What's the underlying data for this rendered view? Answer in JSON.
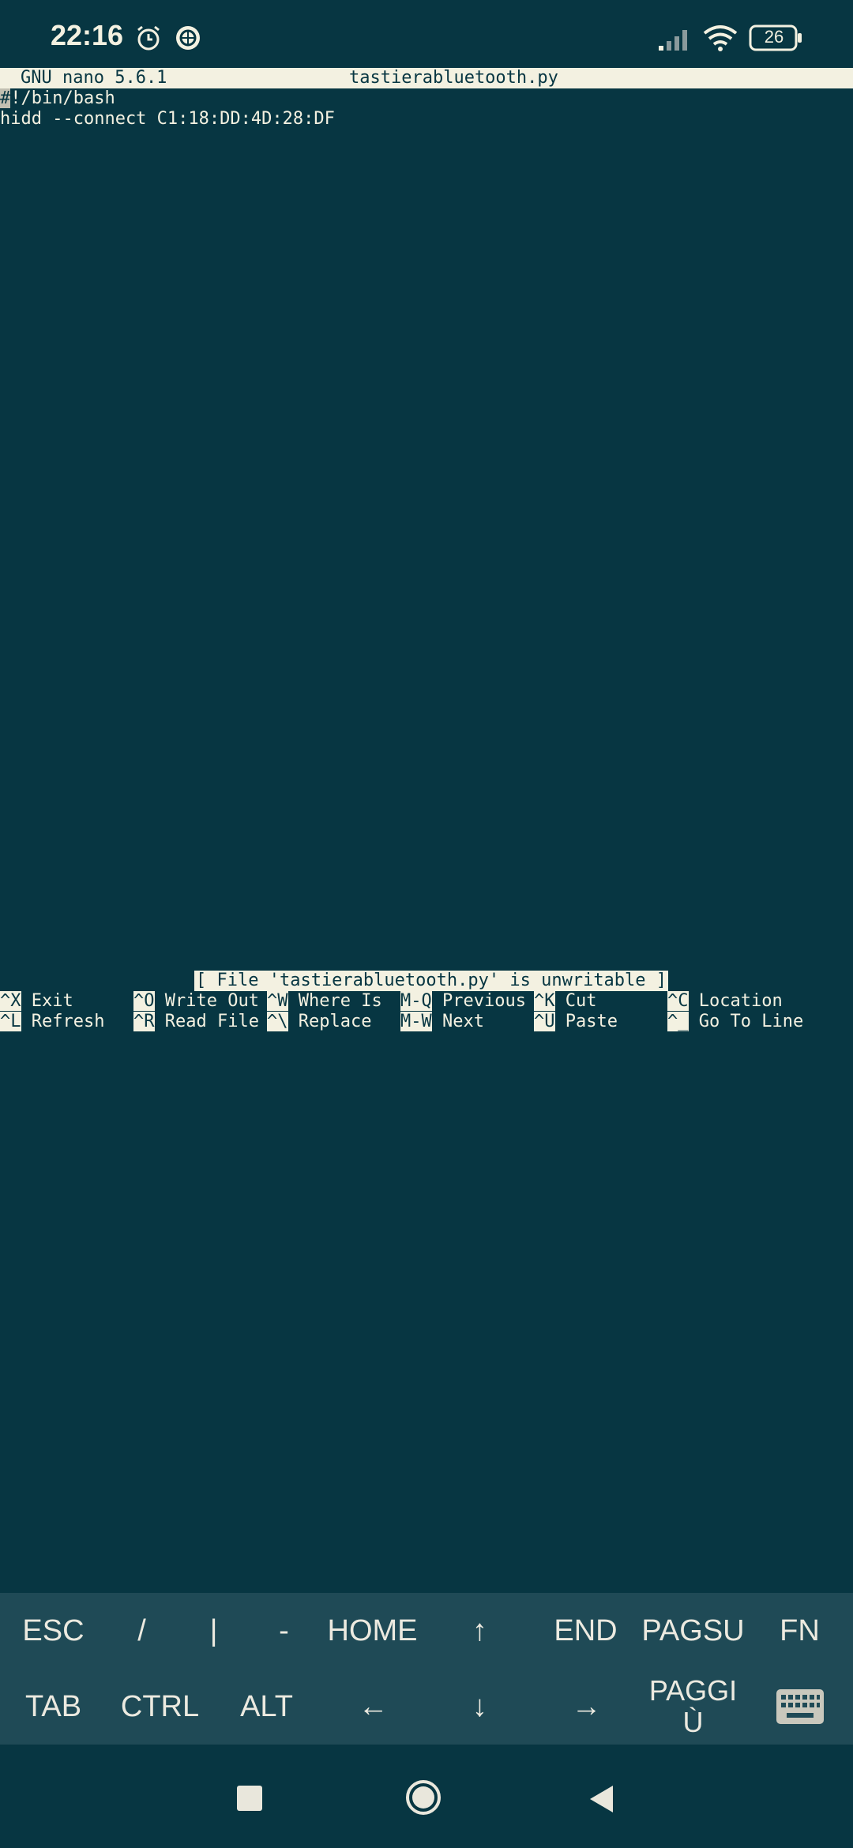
{
  "status_bar": {
    "time": "22:16",
    "battery": "26",
    "icons": [
      "alarm-icon",
      "app-notification-icon",
      "signal-icon",
      "wifi-icon",
      "battery-icon"
    ]
  },
  "nano": {
    "version": "GNU nano 5.6.1",
    "filename": "tastierabluetooth.py",
    "lines": [
      "#!/bin/bash",
      "hidd --connect C1:18:DD:4D:28:DF"
    ],
    "status_message": "[ File 'tastierabluetooth.py' is unwritable ]",
    "shortcuts_row1": [
      {
        "key": "^X",
        "label": "Exit"
      },
      {
        "key": "^O",
        "label": "Write Out"
      },
      {
        "key": "^W",
        "label": "Where Is"
      },
      {
        "key": "M-Q",
        "label": "Previous"
      },
      {
        "key": "^K",
        "label": "Cut"
      },
      {
        "key": "^C",
        "label": "Location"
      }
    ],
    "shortcuts_row2": [
      {
        "key": "^L",
        "label": "Refresh"
      },
      {
        "key": "^R",
        "label": "Read File"
      },
      {
        "key": "^\\",
        "label": "Replace"
      },
      {
        "key": "M-W",
        "label": "Next"
      },
      {
        "key": "^U",
        "label": "Paste"
      },
      {
        "key": "^_",
        "label": "Go To Line"
      }
    ]
  },
  "extra_keys": {
    "row1": [
      "ESC",
      "/",
      "|",
      "-",
      "HOME",
      "↑",
      "END",
      "PAGSU",
      "FN"
    ],
    "row2": [
      "TAB",
      "CTRL",
      "ALT",
      "←",
      "↓",
      "→",
      "PAGGIÙ",
      "keyboard-icon"
    ]
  },
  "colors": {
    "background": "#073642",
    "foreground": "#f3f1e1",
    "extra_keys_bg": "#1f4a56"
  }
}
